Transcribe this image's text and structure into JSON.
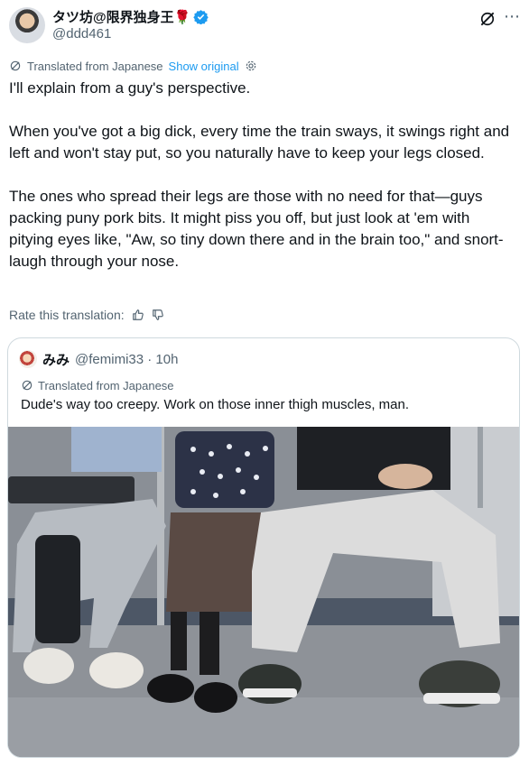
{
  "author": {
    "display_name": "タツ坊@限界独身王🌹",
    "handle": "@ddd461"
  },
  "translation": {
    "label": "Translated from Japanese",
    "show_original": "Show original"
  },
  "post": {
    "paragraphs": [
      "I'll explain from a guy's perspective.",
      "When you've got a big dick, every time the train sways, it swings right and left and won't stay put, so you naturally have to keep your legs closed.",
      "The ones who spread their legs are those with no need for that—guys packing puny pork bits. It might piss you off, but just look at 'em with pitying eyes like, \"Aw, so tiny down there and in the brain too,\" and snort-laugh through your nose."
    ]
  },
  "rate": {
    "label": "Rate this translation:"
  },
  "quote": {
    "display_name": "みみ",
    "meta": "@femimi33 · 10h",
    "translated_label": "Translated from Japanese",
    "text": "Dude's way too creepy. Work on those inner thigh muscles, man."
  },
  "colors": {
    "link": "#1d9bf0",
    "secondary_text": "#536471",
    "verified": "#1d9bf0",
    "border": "#cfd9de"
  }
}
